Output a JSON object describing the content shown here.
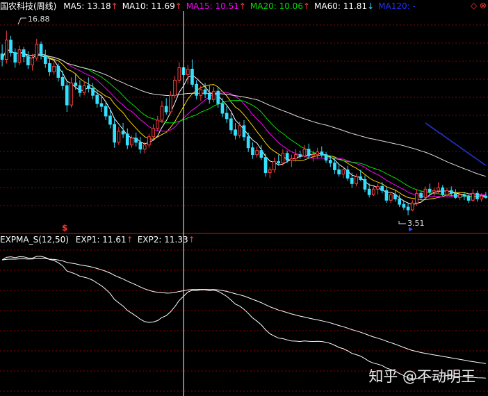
{
  "header_main": {
    "title": "国农科技(周线)",
    "indicators": [
      {
        "label": "MA5: 13.18",
        "arrow": "↑",
        "color": "#ffffff"
      },
      {
        "label": "MA10: 11.69",
        "arrow": "↑",
        "color": "#ffffff"
      },
      {
        "label": "MA15: 10.51",
        "arrow": "↑",
        "color": "#ff00ff"
      },
      {
        "label": "MA20: 10.06",
        "arrow": "↑",
        "color": "#00e000"
      },
      {
        "label": "MA60: 11.81",
        "arrow": "↓",
        "color": "#ffffff"
      },
      {
        "label": "MA120: -",
        "arrow": "",
        "color": "#2233ff"
      }
    ],
    "corner_icons": "◇ ⊗"
  },
  "header_sub": {
    "title": "EXPMA_S(12,50)",
    "indicators": [
      {
        "label": "EXP1: 11.61",
        "arrow": "↑",
        "color": "#ffffff"
      },
      {
        "label": "EXP2: 11.33",
        "arrow": "↑",
        "color": "#ffffff"
      }
    ]
  },
  "annotations": {
    "high_label": "16.88",
    "low_label": "3.51",
    "s_marker": "$"
  },
  "watermark": "知乎 @不动明王",
  "colors": {
    "up": "#ff4040",
    "down": "#35e0ff",
    "grid": "#8b0000",
    "divider": "#b00000",
    "ma120": "#2233cc"
  },
  "chart_data": {
    "type": "candlestick",
    "price_range": [
      3.0,
      18.2
    ],
    "high": 16.88,
    "low": 3.51,
    "candles": [
      [
        15.2,
        15.9,
        14.3,
        14.8
      ],
      [
        14.8,
        16.88,
        14.5,
        16.2
      ],
      [
        16.2,
        16.5,
        15.0,
        15.3
      ],
      [
        15.3,
        15.6,
        14.2,
        14.6
      ],
      [
        14.6,
        15.8,
        14.4,
        15.5
      ],
      [
        15.5,
        15.7,
        14.6,
        15.0
      ],
      [
        15.0,
        15.4,
        14.1,
        14.4
      ],
      [
        14.4,
        15.2,
        14.0,
        14.9
      ],
      [
        14.9,
        16.3,
        14.7,
        15.9
      ],
      [
        15.9,
        16.1,
        14.8,
        15.1
      ],
      [
        15.1,
        15.5,
        14.2,
        14.5
      ],
      [
        14.5,
        14.9,
        13.6,
        13.9
      ],
      [
        13.9,
        14.6,
        13.7,
        14.3
      ],
      [
        14.3,
        14.5,
        13.2,
        13.5
      ],
      [
        13.5,
        14.0,
        12.6,
        12.9
      ],
      [
        12.9,
        13.2,
        11.0,
        11.5
      ],
      [
        11.5,
        13.5,
        11.3,
        13.1
      ],
      [
        13.1,
        13.8,
        12.6,
        12.9
      ],
      [
        12.9,
        13.3,
        12.1,
        12.4
      ],
      [
        12.4,
        13.2,
        12.2,
        12.9
      ],
      [
        12.9,
        13.5,
        12.4,
        12.7
      ],
      [
        12.7,
        13.1,
        11.9,
        12.2
      ],
      [
        12.2,
        12.6,
        11.3,
        11.6
      ],
      [
        11.6,
        12.2,
        11.0,
        11.4
      ],
      [
        11.4,
        11.8,
        10.4,
        10.7
      ],
      [
        10.7,
        11.2,
        9.8,
        10.1
      ],
      [
        10.1,
        10.6,
        8.4,
        8.8
      ],
      [
        8.8,
        9.9,
        8.6,
        9.6
      ],
      [
        9.6,
        10.2,
        9.1,
        9.4
      ],
      [
        9.4,
        9.8,
        8.3,
        8.6
      ],
      [
        8.6,
        9.3,
        8.4,
        9.1
      ],
      [
        9.1,
        9.5,
        8.5,
        8.8
      ],
      [
        8.8,
        9.2,
        8.0,
        8.3
      ],
      [
        8.3,
        8.8,
        8.0,
        8.6
      ],
      [
        8.6,
        9.4,
        8.4,
        9.2
      ],
      [
        9.2,
        10.1,
        9.0,
        9.8
      ],
      [
        9.8,
        10.7,
        9.6,
        10.4
      ],
      [
        10.4,
        11.8,
        10.2,
        11.4
      ],
      [
        11.4,
        12.0,
        10.8,
        11.0
      ],
      [
        11.0,
        12.5,
        10.9,
        12.2
      ],
      [
        12.2,
        13.6,
        12.0,
        13.3
      ],
      [
        13.3,
        14.6,
        13.1,
        14.2
      ],
      [
        14.2,
        14.9,
        13.4,
        13.7
      ],
      [
        13.7,
        14.4,
        13.0,
        14.1
      ],
      [
        14.1,
        14.8,
        12.8,
        13.0
      ],
      [
        13.0,
        13.3,
        11.9,
        12.2
      ],
      [
        12.2,
        12.9,
        11.8,
        12.6
      ],
      [
        12.6,
        13.1,
        12.0,
        12.3
      ],
      [
        12.3,
        12.9,
        11.6,
        11.9
      ],
      [
        11.9,
        12.8,
        11.7,
        12.5
      ],
      [
        12.5,
        12.8,
        11.3,
        11.6
      ],
      [
        11.6,
        12.0,
        10.6,
        10.9
      ],
      [
        10.9,
        11.4,
        10.2,
        10.5
      ],
      [
        10.5,
        10.9,
        9.4,
        9.7
      ],
      [
        9.7,
        10.2,
        9.0,
        9.3
      ],
      [
        9.3,
        10.3,
        9.1,
        10.0
      ],
      [
        10.0,
        10.4,
        8.9,
        9.2
      ],
      [
        9.2,
        9.5,
        8.1,
        8.4
      ],
      [
        8.4,
        8.8,
        7.6,
        7.9
      ],
      [
        7.9,
        8.5,
        7.7,
        8.2
      ],
      [
        8.2,
        8.6,
        7.5,
        7.7
      ],
      [
        7.7,
        8.0,
        6.3,
        6.6
      ],
      [
        6.6,
        7.0,
        6.2,
        6.8
      ],
      [
        6.8,
        7.7,
        6.6,
        7.4
      ],
      [
        7.4,
        7.9,
        7.1,
        7.3
      ],
      [
        7.3,
        8.3,
        7.1,
        8.0
      ],
      [
        8.0,
        8.2,
        7.3,
        7.5
      ],
      [
        7.5,
        7.9,
        7.0,
        7.6
      ],
      [
        7.6,
        8.3,
        7.4,
        7.9
      ],
      [
        7.9,
        8.2,
        7.6,
        7.8
      ],
      [
        7.8,
        8.6,
        7.7,
        8.3
      ],
      [
        8.3,
        8.7,
        7.6,
        7.8
      ],
      [
        7.8,
        8.2,
        7.4,
        7.9
      ],
      [
        7.9,
        8.4,
        7.6,
        8.1
      ],
      [
        8.1,
        8.5,
        7.7,
        7.9
      ],
      [
        7.9,
        8.1,
        7.3,
        7.5
      ],
      [
        7.5,
        7.8,
        7.0,
        7.3
      ],
      [
        7.3,
        7.6,
        6.5,
        6.8
      ],
      [
        6.8,
        7.2,
        6.3,
        6.5
      ],
      [
        6.5,
        7.0,
        6.2,
        6.8
      ],
      [
        6.8,
        7.1,
        6.0,
        6.2
      ],
      [
        6.2,
        6.6,
        5.5,
        5.8
      ],
      [
        5.8,
        6.5,
        5.6,
        6.3
      ],
      [
        6.3,
        6.8,
        6.0,
        6.1
      ],
      [
        6.1,
        6.4,
        5.2,
        5.4
      ],
      [
        5.4,
        5.8,
        4.8,
        5.0
      ],
      [
        5.0,
        5.6,
        4.9,
        5.4
      ],
      [
        5.4,
        5.8,
        5.0,
        5.6
      ],
      [
        5.6,
        5.9,
        5.1,
        5.3
      ],
      [
        5.3,
        5.5,
        4.4,
        4.6
      ],
      [
        4.6,
        5.2,
        4.4,
        5.0
      ],
      [
        5.0,
        5.3,
        4.5,
        4.7
      ],
      [
        4.7,
        5.0,
        4.1,
        4.3
      ],
      [
        4.3,
        4.6,
        3.9,
        4.1
      ],
      [
        4.1,
        4.4,
        3.51,
        3.9
      ],
      [
        3.9,
        4.6,
        3.8,
        4.4
      ],
      [
        4.4,
        5.4,
        4.2,
        5.1
      ],
      [
        5.1,
        5.3,
        4.6,
        4.8
      ],
      [
        4.8,
        5.6,
        4.7,
        5.4
      ],
      [
        5.4,
        5.8,
        5.0,
        5.2
      ],
      [
        5.2,
        5.5,
        4.9,
        5.3
      ],
      [
        5.3,
        5.9,
        5.1,
        5.5
      ],
      [
        5.5,
        5.7,
        4.9,
        5.0
      ],
      [
        5.0,
        5.5,
        4.9,
        5.3
      ],
      [
        5.3,
        5.6,
        4.9,
        5.1
      ],
      [
        5.1,
        5.4,
        4.7,
        4.8
      ],
      [
        4.8,
        5.2,
        4.6,
        5.0
      ],
      [
        5.0,
        5.2,
        4.6,
        4.9
      ],
      [
        4.9,
        5.0,
        4.4,
        4.6
      ],
      [
        4.6,
        5.4,
        4.5,
        5.1
      ],
      [
        5.1,
        5.3,
        4.5,
        4.7
      ],
      [
        4.7,
        5.1,
        4.5,
        4.9
      ],
      [
        4.9,
        5.2,
        4.7,
        4.8
      ]
    ],
    "ma_series": [
      {
        "name": "MA5",
        "period": 5,
        "color": "#ffffff"
      },
      {
        "name": "MA10",
        "period": 10,
        "color": "#ffd700"
      },
      {
        "name": "MA15",
        "period": 15,
        "color": "#ff00ff"
      },
      {
        "name": "MA20",
        "period": 20,
        "color": "#00e000"
      },
      {
        "name": "MA60",
        "period": 60,
        "color": "#dddddd"
      },
      {
        "name": "MA120",
        "period": 120,
        "color": "#2233cc"
      }
    ],
    "expma": {
      "short": 12,
      "long": 50,
      "range": [
        4.0,
        16.2
      ],
      "series": [
        "EXP1",
        "EXP2"
      ],
      "color": "#ffffff"
    },
    "crosshair_index": 42
  }
}
